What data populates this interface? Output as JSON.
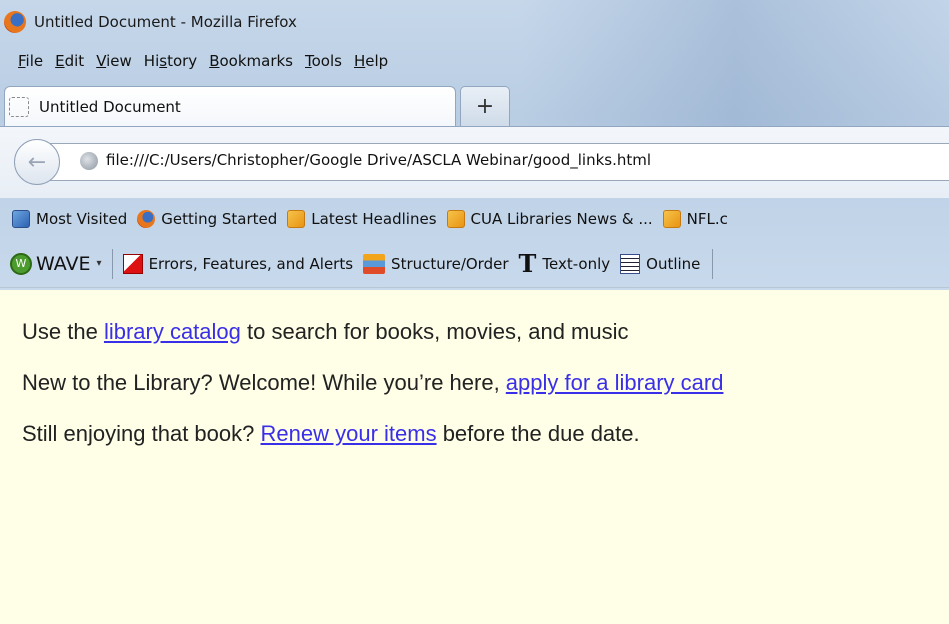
{
  "window": {
    "title": "Untitled Document - Mozilla Firefox",
    "app_icon": "firefox-icon"
  },
  "menubar": {
    "items": [
      {
        "accel": "F",
        "rest": "ile"
      },
      {
        "accel": "E",
        "rest": "dit"
      },
      {
        "accel": "V",
        "rest": "iew"
      },
      {
        "pre": "Hi",
        "accel": "s",
        "rest": "tory"
      },
      {
        "accel": "B",
        "rest": "ookmarks"
      },
      {
        "accel": "T",
        "rest": "ools"
      },
      {
        "accel": "H",
        "rest": "elp"
      }
    ]
  },
  "tabs": {
    "active_label": "Untitled Document",
    "new_tab": "+"
  },
  "navbar": {
    "url": "file:///C:/Users/Christopher/Google Drive/ASCLA Webinar/good_links.html"
  },
  "bookmarks": {
    "items": [
      {
        "label": "Most Visited",
        "icon": "most-visited-icon"
      },
      {
        "label": "Getting Started",
        "icon": "firefox-icon"
      },
      {
        "label": "Latest Headlines",
        "icon": "rss-icon"
      },
      {
        "label": "CUA Libraries News & ...",
        "icon": "rss-icon"
      },
      {
        "label": "NFL.c",
        "icon": "rss-icon"
      }
    ]
  },
  "wave": {
    "label": "WAVE",
    "dropdown": "▾",
    "items": [
      {
        "label": "Errors, Features, and Alerts",
        "icon": "errors-icon"
      },
      {
        "label": "Structure/Order",
        "icon": "structure-icon"
      },
      {
        "label": "Text-only",
        "icon": "text-only-icon",
        "glyph": "T"
      },
      {
        "label": "Outline",
        "icon": "outline-icon"
      }
    ]
  },
  "content": {
    "line1": {
      "pre": "Use the ",
      "link": "library catalog",
      "post": " to search for books, movies, and music"
    },
    "line2": {
      "pre": "New to the Library? Welcome! While you’re here, ",
      "link": "apply for a library card",
      "post": ""
    },
    "line3": {
      "pre": "Still enjoying that book? ",
      "link": "Renew your items",
      "post": " before the due date."
    }
  },
  "colors": {
    "page_background": "#ffffe8",
    "link": "#3a2fe8"
  }
}
